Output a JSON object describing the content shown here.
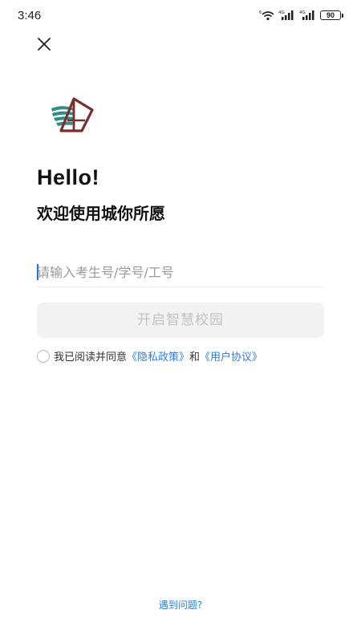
{
  "status_bar": {
    "time": "3:46",
    "battery": "90",
    "icons": [
      "wifi-icon",
      "signal-4g-icon",
      "signal-4g-icon",
      "battery-icon"
    ]
  },
  "header": {
    "close_icon": "close-icon"
  },
  "logo": {
    "icon": "school-logo",
    "colors": {
      "teal": "#2f8f86",
      "maroon": "#7a2e2e"
    }
  },
  "greeting": {
    "hello": "Hello!",
    "welcome": "欢迎使用城你所愿"
  },
  "login": {
    "id_placeholder": "请输入考生号/学号/工号",
    "id_value": "",
    "start_button": "开启智慧校园",
    "agreement": {
      "prefix": "我已阅读并同意",
      "privacy_link": "《隐私政策》",
      "and": "和",
      "user_link": "《用户协议》",
      "checked": false
    }
  },
  "footer": {
    "help_link": "遇到问题?"
  },
  "colors": {
    "link": "#2a7de1",
    "button_bg": "#f2f2f2",
    "button_text_disabled": "#c3c3c3"
  }
}
